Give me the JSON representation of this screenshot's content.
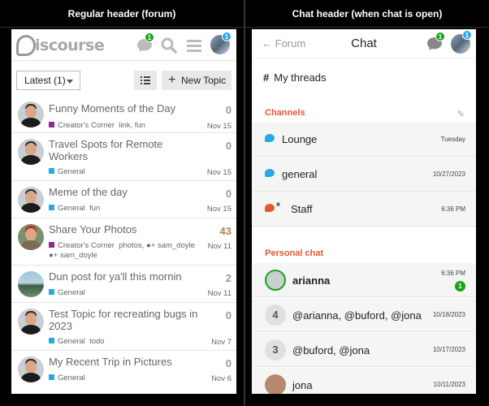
{
  "columns": {
    "left_title": "Regular header (forum)",
    "right_title": "Chat header (when chat is open)"
  },
  "forum": {
    "logo_text": "iscourse",
    "chat_badge": "1",
    "avatar_badge": "1",
    "latest_label": "Latest (1)",
    "new_topic_label": "New Topic",
    "topics": [
      {
        "title": "Funny Moments of the Day",
        "count": "0",
        "category": "Creator's Corner",
        "category_color": "#92278f",
        "tags": "link, fun",
        "date": "Nov 15",
        "avatar": "man"
      },
      {
        "title": "Travel Spots for Remote Workers",
        "count": "0",
        "category": "General",
        "category_color": "#25aae1",
        "tags": "",
        "date": "Nov 15",
        "avatar": "man"
      },
      {
        "title": "Meme of the day",
        "count": "0",
        "category": "General",
        "category_color": "#25aae1",
        "tags": "fun",
        "date": "Nov 15",
        "avatar": "man"
      },
      {
        "title": "Share Your Photos",
        "count": "43",
        "category": "Creator's Corner",
        "category_color": "#92278f",
        "tags": "photos,",
        "extra1": "sam_doyle",
        "extra2": "sam_doyle",
        "date": "Nov 11",
        "avatar": "hat"
      },
      {
        "title": "Dun post for ya'll this mornin",
        "count": "2",
        "category": "General",
        "category_color": "#25aae1",
        "tags": "",
        "date": "Nov 11",
        "avatar": "landscape"
      },
      {
        "title": "Test Topic for recreating bugs in 2023",
        "count": "0",
        "category": "General",
        "category_color": "#25aae1",
        "tags": "todo",
        "date": "Nov 7",
        "avatar": "man"
      },
      {
        "title": "My Recent Trip in Pictures",
        "count": "0",
        "category": "General",
        "category_color": "#25aae1",
        "tags": "",
        "date": "Nov 6",
        "avatar": "man"
      }
    ]
  },
  "chat": {
    "back_label": "Forum",
    "title": "Chat",
    "chat_badge": "1",
    "avatar_badge": "1",
    "threads_label": "My threads",
    "channels_label": "Channels",
    "channels": [
      {
        "name": "Lounge",
        "date": "Tuesday",
        "color": "#25aae1"
      },
      {
        "name": "general",
        "date": "10/27/2023",
        "color": "#25aae1"
      },
      {
        "name": "Staff",
        "date": "6:36 PM",
        "color": "#e45735",
        "locked": true
      }
    ],
    "personal_label": "Personal chat",
    "dms": [
      {
        "name": "arianna",
        "date": "6:36 PM",
        "unread": "1",
        "type": "avatar"
      },
      {
        "name": "@arianna, @buford, @jona",
        "date": "10/18/2023",
        "num": "4",
        "type": "num"
      },
      {
        "name": "@buford, @jona",
        "date": "10/17/2023",
        "num": "3",
        "type": "num"
      },
      {
        "name": "jona",
        "date": "10/11/2023",
        "type": "avatar2"
      }
    ]
  }
}
